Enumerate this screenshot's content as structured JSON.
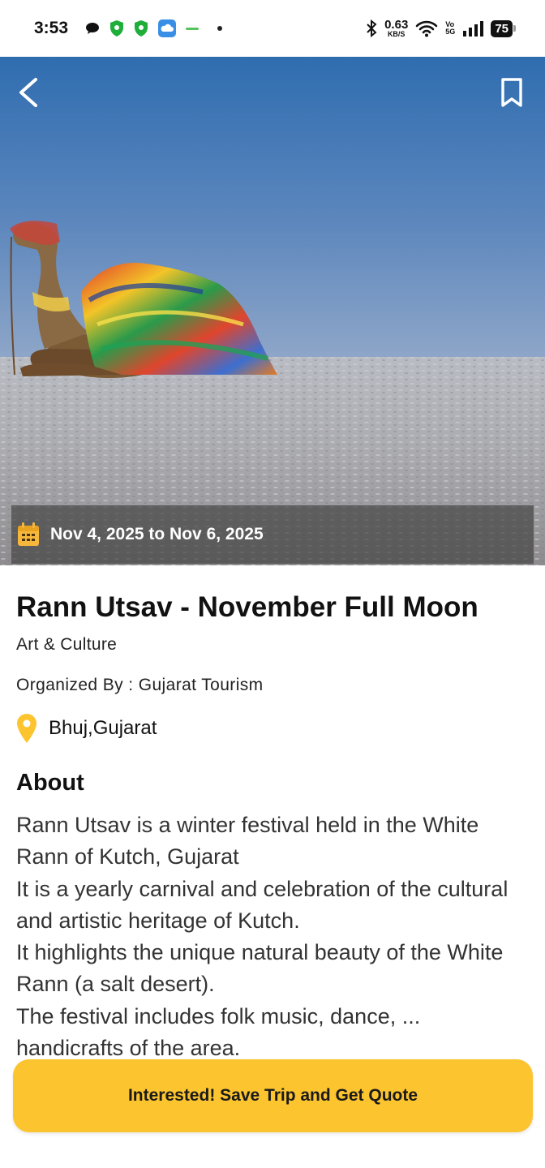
{
  "status_bar": {
    "time": "3:53",
    "net_speed": "0.63",
    "net_unit": "KB/S",
    "volte_top": "Vo",
    "volte_bottom": "5G",
    "battery": "75"
  },
  "event": {
    "date_range": "Nov 4, 2025 to Nov 6, 2025",
    "title": "Rann Utsav - November Full Moon",
    "category": "Art & Culture",
    "organizer": "Organized By : Gujarat Tourism",
    "location": "Bhuj,Gujarat",
    "about_heading": "About",
    "about_text": "Rann Utsav is a winter festival held in the White Rann of Kutch, Gujarat\nIt is a yearly carnival and celebration of the cultural and artistic heritage of Kutch.\nIt highlights the unique natural beauty of the White Rann (a salt desert).\nThe festival includes folk music, dance, ... handicrafts of the area."
  },
  "cta": {
    "label": "Interested! Save Trip and Get Quote"
  },
  "colors": {
    "accent": "#fcc42e",
    "date_overlay": "#464646"
  },
  "icons": {
    "back": "back-arrow-icon",
    "bookmark": "bookmark-icon",
    "calendar": "calendar-icon",
    "location": "location-pin-icon"
  }
}
